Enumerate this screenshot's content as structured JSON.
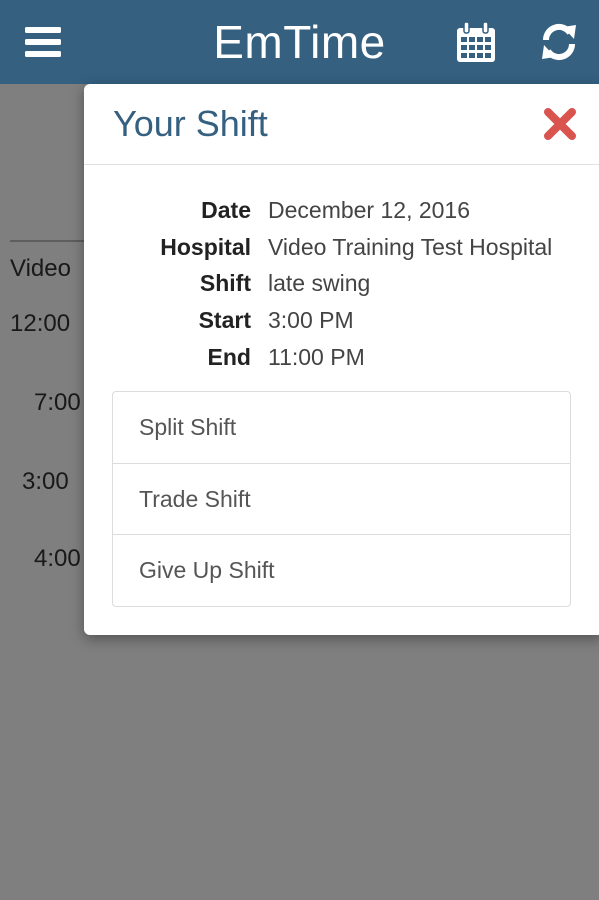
{
  "header": {
    "title": "EmTime",
    "menu_icon": "hamburger-menu-icon",
    "calendar_icon": "calendar-icon",
    "refresh_icon": "refresh-icon",
    "background_color": "#356080"
  },
  "background": {
    "visible_text": [
      "Video",
      "12:00",
      "7:00",
      "3:00",
      "4:00"
    ]
  },
  "modal": {
    "title": "Your Shift",
    "close_icon": "close-icon",
    "close_color": "#d9534f",
    "details": [
      {
        "label": "Date",
        "value": "December 12, 2016"
      },
      {
        "label": "Hospital",
        "value": "Video Training Test Hospital"
      },
      {
        "label": "Shift",
        "value": "late swing"
      },
      {
        "label": "Start",
        "value": "3:00 PM"
      },
      {
        "label": "End",
        "value": "11:00 PM"
      }
    ],
    "actions": [
      "Split Shift",
      "Trade Shift",
      "Give Up Shift"
    ]
  }
}
